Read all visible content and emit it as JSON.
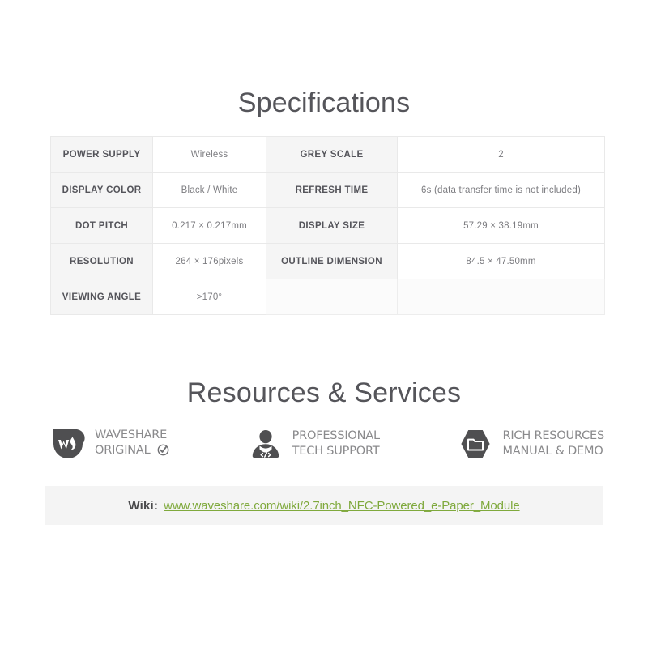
{
  "specifications": {
    "title": "Specifications",
    "rows": [
      {
        "label_left": "POWER SUPPLY",
        "value_left": "Wireless",
        "label_right": "GREY SCALE",
        "value_right": "2"
      },
      {
        "label_left": "DISPLAY COLOR",
        "value_left": "Black / White",
        "label_right": "REFRESH TIME",
        "value_right": "6s (data transfer time is not included)"
      },
      {
        "label_left": "DOT PITCH",
        "value_left": "0.217 × 0.217mm",
        "label_right": "DISPLAY SIZE",
        "value_right": "57.29 × 38.19mm"
      },
      {
        "label_left": "RESOLUTION",
        "value_left": "264 × 176pixels",
        "label_right": "OUTLINE DIMENSION",
        "value_right": "84.5 × 47.50mm"
      },
      {
        "label_left": "VIEWING ANGLE",
        "value_left": ">170°",
        "label_right": "",
        "value_right": ""
      }
    ]
  },
  "resources": {
    "title": "Resources & Services",
    "services": [
      {
        "icon": "waveshare-logo-icon",
        "line1": "WAVESHARE",
        "line2": "ORIGINAL",
        "has_check": true
      },
      {
        "icon": "tech-support-person-icon",
        "line1": "PROFESSIONAL",
        "line2": "TECH SUPPORT",
        "has_check": false
      },
      {
        "icon": "folder-hexagon-icon",
        "line1": "RICH RESOURCES",
        "line2": "MANUAL & DEMO",
        "has_check": false
      }
    ]
  },
  "wiki": {
    "label": "Wiki:",
    "url": "www.waveshare.com/wiki/2.7inch_NFC-Powered_e-Paper_Module"
  },
  "colors": {
    "heading": "#55555a",
    "label_cell_bg": "#f5f5f5",
    "table_border": "#e9e9e9",
    "link_green": "#7fa93c",
    "icon_dark": "#4f4f51",
    "wiki_bar_bg": "#f4f4f4"
  }
}
